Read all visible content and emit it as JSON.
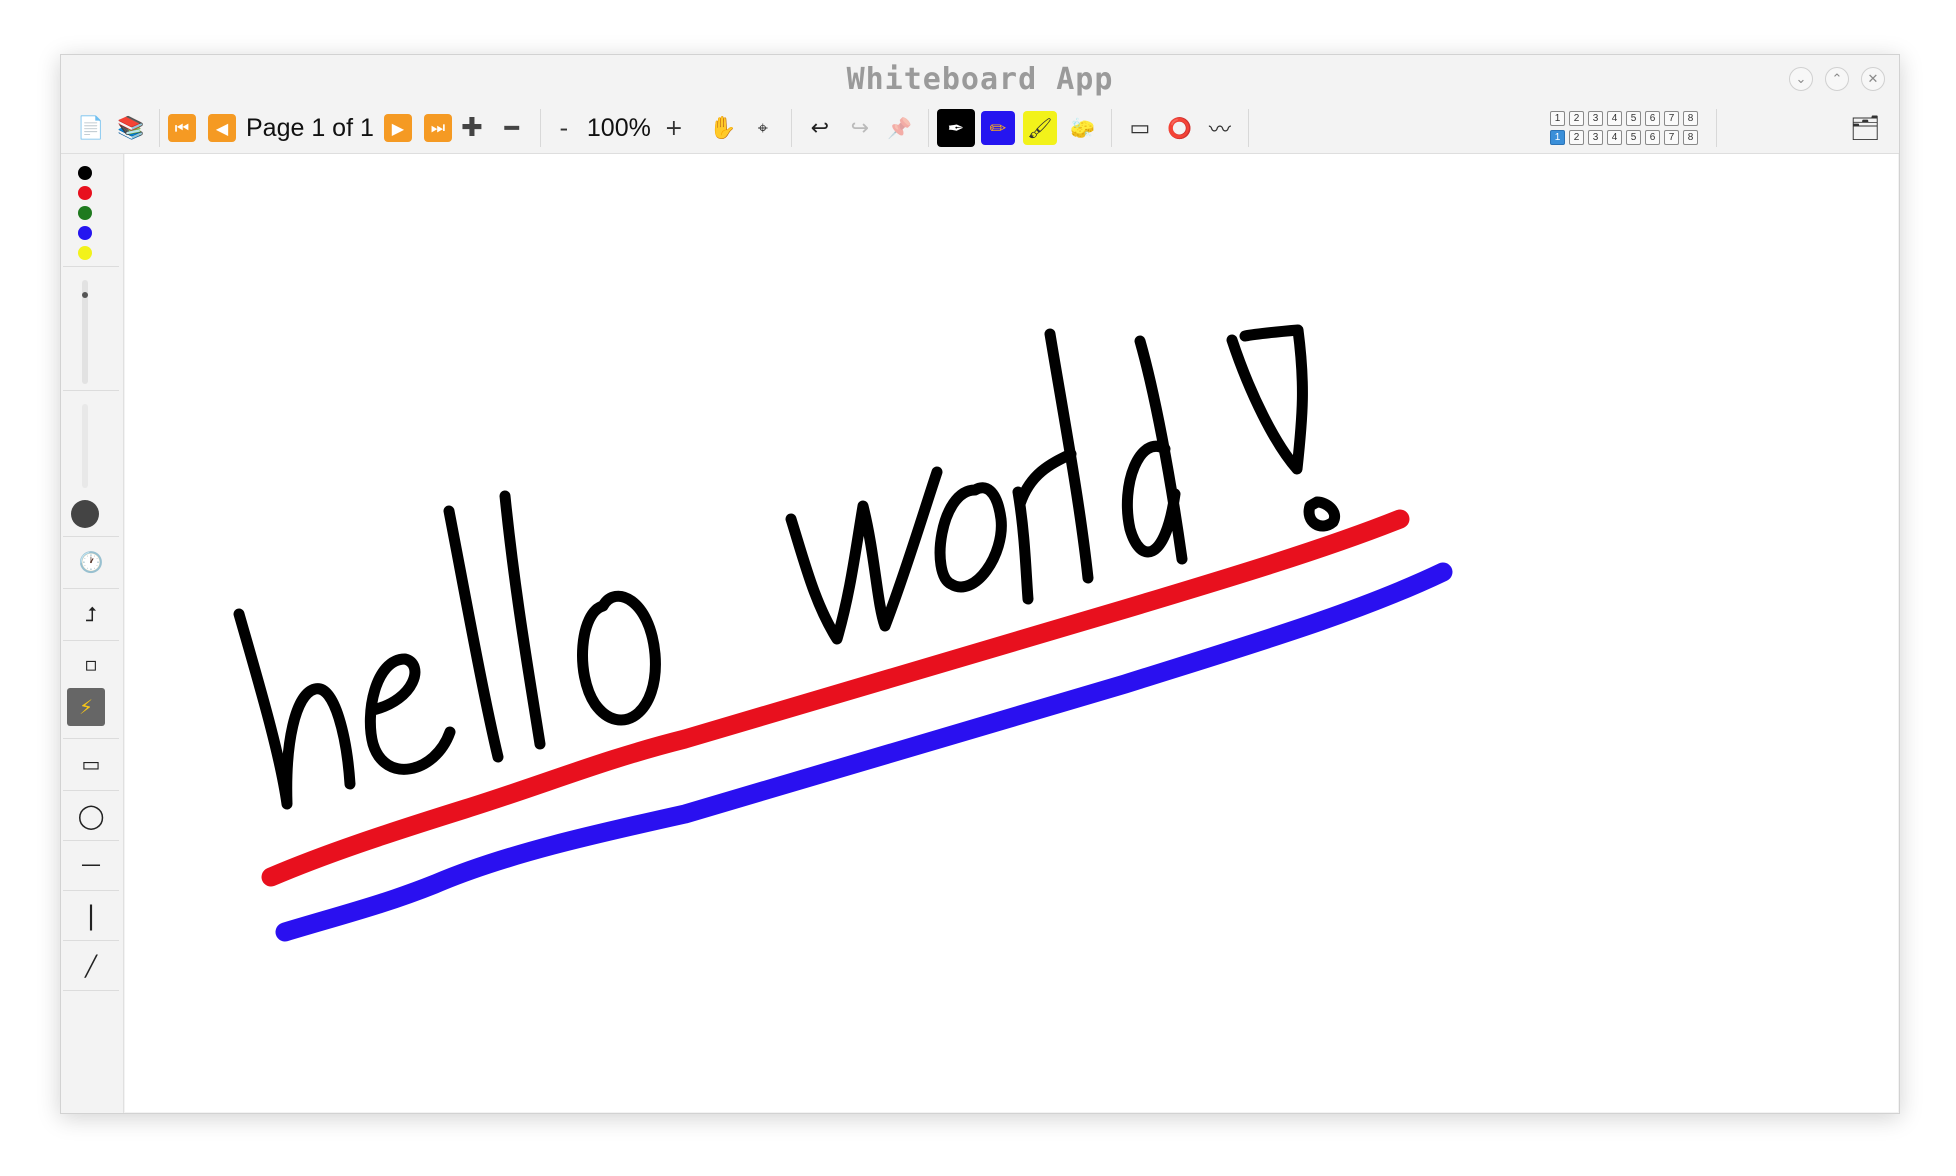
{
  "window": {
    "title": "Whiteboard App"
  },
  "toolbar": {
    "page_text": "Page 1 of 1",
    "zoom_minus": "-",
    "zoom_text": "100%",
    "zoom_plus": "+",
    "icons": {
      "new_page": "📄",
      "library": "📚",
      "first_page": "⏮",
      "prev_page": "◀",
      "next_page": "▶",
      "last_page": "⏭",
      "add_page": "✚",
      "remove_page": "━",
      "pan": "✋",
      "pointer": "⌖",
      "undo": "↩",
      "redo": "↪",
      "pin": "📌",
      "pen": "✒",
      "marker": "✏",
      "highlighter": "🖌",
      "eraser": "🧽",
      "rect_shape": "▭",
      "circle_shape": "⭕",
      "wave_shape": "〰",
      "folder": "🗂"
    },
    "layer_rows": [
      [
        "1",
        "2",
        "3",
        "4",
        "5",
        "6",
        "7",
        "8"
      ],
      [
        "1",
        "2",
        "3",
        "4",
        "5",
        "6",
        "7",
        "8"
      ]
    ],
    "active_layer": "1"
  },
  "sidebar": {
    "colors": [
      "#000000",
      "#e8101e",
      "#1f7a1f",
      "#2515f0",
      "#f2f21a"
    ],
    "tools": {
      "clock": "🕐",
      "arrow_up": "⮥",
      "small_square": "▫",
      "lightning": "⚡",
      "rectangle": "▭",
      "circle": "◯",
      "h_line": "—",
      "v_line": "|",
      "diag_line": "╱"
    },
    "active_tool": "lightning"
  },
  "colors": {
    "accent": "#3a8fd9",
    "ink_black": "#000000",
    "ink_red": "#e8101e",
    "ink_blue": "#2a10f0"
  },
  "canvas": {
    "handwriting": "hello world !"
  }
}
